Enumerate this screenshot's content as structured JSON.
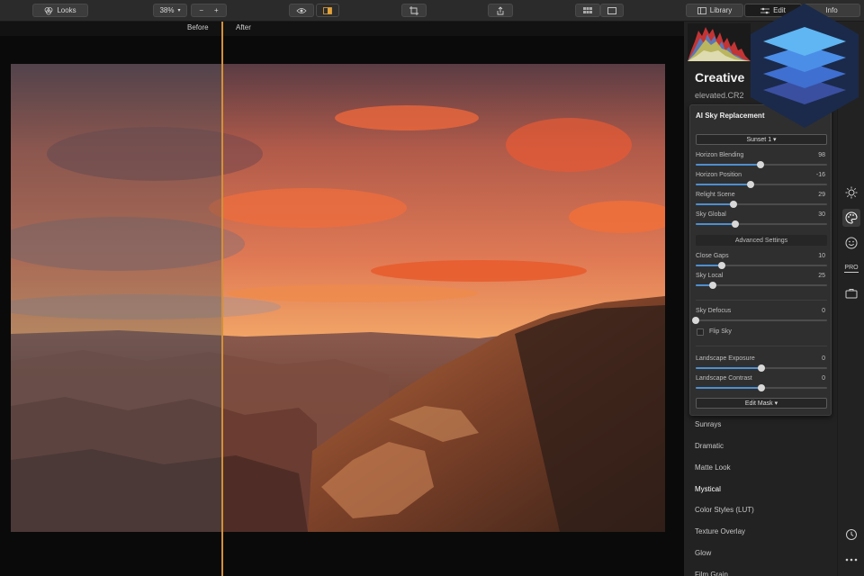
{
  "toolbar": {
    "looks_label": "Looks",
    "zoom_label": "38%",
    "zoom_minus": "−",
    "zoom_plus": "+",
    "library_label": "Library",
    "edit_label": "Edit",
    "info_label": "Info"
  },
  "compare": {
    "before_label": "Before",
    "after_label": "After"
  },
  "panel": {
    "title": "Creative",
    "file_name": "elevated.CR2"
  },
  "sky_panel": {
    "title": "AI Sky Replacement",
    "sky_select": "Sunset 1 ▾",
    "advanced_label": "Advanced Settings",
    "flip_sky_label": "Flip Sky",
    "flip_sky_checked": false,
    "edit_mask_label": "Edit Mask ▾",
    "sliders": [
      {
        "label": "Horizon Blending",
        "value": "98",
        "position": 0.49
      },
      {
        "label": "Horizon Position",
        "value": "-16",
        "position": 0.42
      },
      {
        "label": "Relight Scene",
        "value": "29",
        "position": 0.29
      },
      {
        "label": "Sky Global",
        "value": "30",
        "position": 0.3
      },
      {
        "label": "Close Gaps",
        "value": "10",
        "position": 0.2
      },
      {
        "label": "Sky Local",
        "value": "25",
        "position": 0.13
      },
      {
        "label": "Sky Defocus",
        "value": "0",
        "position": 0.0
      },
      {
        "label": "Landscape Exposure",
        "value": "0",
        "position": 0.5
      },
      {
        "label": "Landscape Contrast",
        "value": "0",
        "position": 0.5
      }
    ]
  },
  "filters": [
    "Sunrays",
    "Dramatic",
    "Matte Look",
    "Mystical",
    "Color Styles (LUT)",
    "Texture Overlay",
    "Glow",
    "Film Grain"
  ],
  "active_filter": "Mystical",
  "rail_icons": [
    "sun-icon",
    "palette-icon",
    "face-icon",
    "pro-icon",
    "briefcase-icon",
    "history-icon",
    "more-icon"
  ],
  "rail_pro_label": "PRO",
  "colors": {
    "accent": "#4e8fd0",
    "split_line": "#d3913a",
    "panel_bg": "#222222"
  }
}
